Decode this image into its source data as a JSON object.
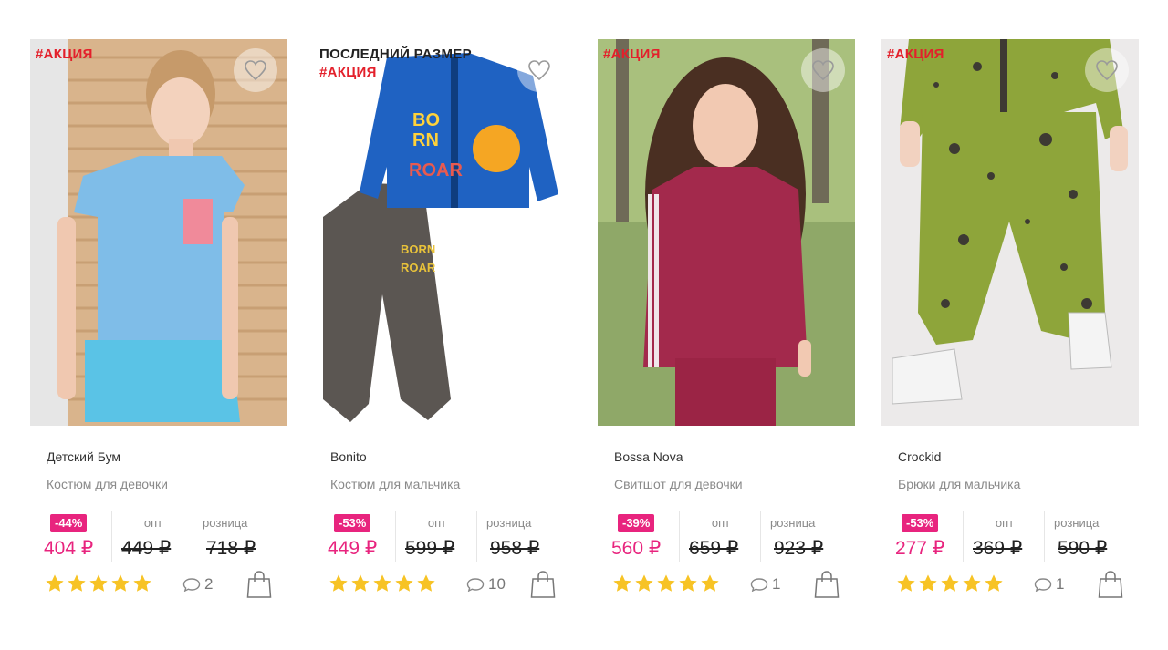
{
  "products": [
    {
      "badges": {
        "last_size": "",
        "promo": "#АКЦИЯ"
      },
      "brand": "Детский Бум",
      "description": "Костюм для девочки",
      "discount": "-44%",
      "price": "404 ₽",
      "opt_label": "опт",
      "opt_price": "449 ₽",
      "retail_label": "розница",
      "retail_price": "718 ₽",
      "rating": 5,
      "comments": "2",
      "icons": {
        "favorite": "heart-outline-icon",
        "comments": "speech-bubble-icon",
        "cart": "shopping-bag-icon"
      }
    },
    {
      "badges": {
        "last_size": "ПОСЛЕДНИЙ РАЗМЕР",
        "promo": "#АКЦИЯ"
      },
      "brand": "Bonito",
      "description": "Костюм для мальчика",
      "discount": "-53%",
      "price": "449 ₽",
      "opt_label": "опт",
      "opt_price": "599 ₽",
      "retail_label": "розница",
      "retail_price": "958 ₽",
      "rating": 5,
      "comments": "10",
      "icons": {
        "favorite": "heart-outline-icon",
        "comments": "speech-bubble-icon",
        "cart": "shopping-bag-icon"
      }
    },
    {
      "badges": {
        "last_size": "",
        "promo": "#АКЦИЯ"
      },
      "brand": "Bossa Nova",
      "description": "Свитшот для девочки",
      "discount": "-39%",
      "price": "560 ₽",
      "opt_label": "опт",
      "opt_price": "659 ₽",
      "retail_label": "розница",
      "retail_price": "923 ₽",
      "rating": 5,
      "comments": "1",
      "icons": {
        "favorite": "heart-outline-icon",
        "comments": "speech-bubble-icon",
        "cart": "shopping-bag-icon"
      }
    },
    {
      "badges": {
        "last_size": "",
        "promo": "#АКЦИЯ"
      },
      "brand": "Crockid",
      "description": "Брюки для мальчика",
      "discount": "-53%",
      "price": "277 ₽",
      "opt_label": "опт",
      "opt_price": "369 ₽",
      "retail_label": "розница",
      "retail_price": "590 ₽",
      "rating": 5,
      "comments": "1",
      "icons": {
        "favorite": "heart-outline-icon",
        "comments": "speech-bubble-icon",
        "cart": "shopping-bag-icon"
      }
    }
  ],
  "colors": {
    "promo": "#e3202b",
    "accent": "#e8247e",
    "star": "#f7c325",
    "muted": "#8a8a8a"
  }
}
